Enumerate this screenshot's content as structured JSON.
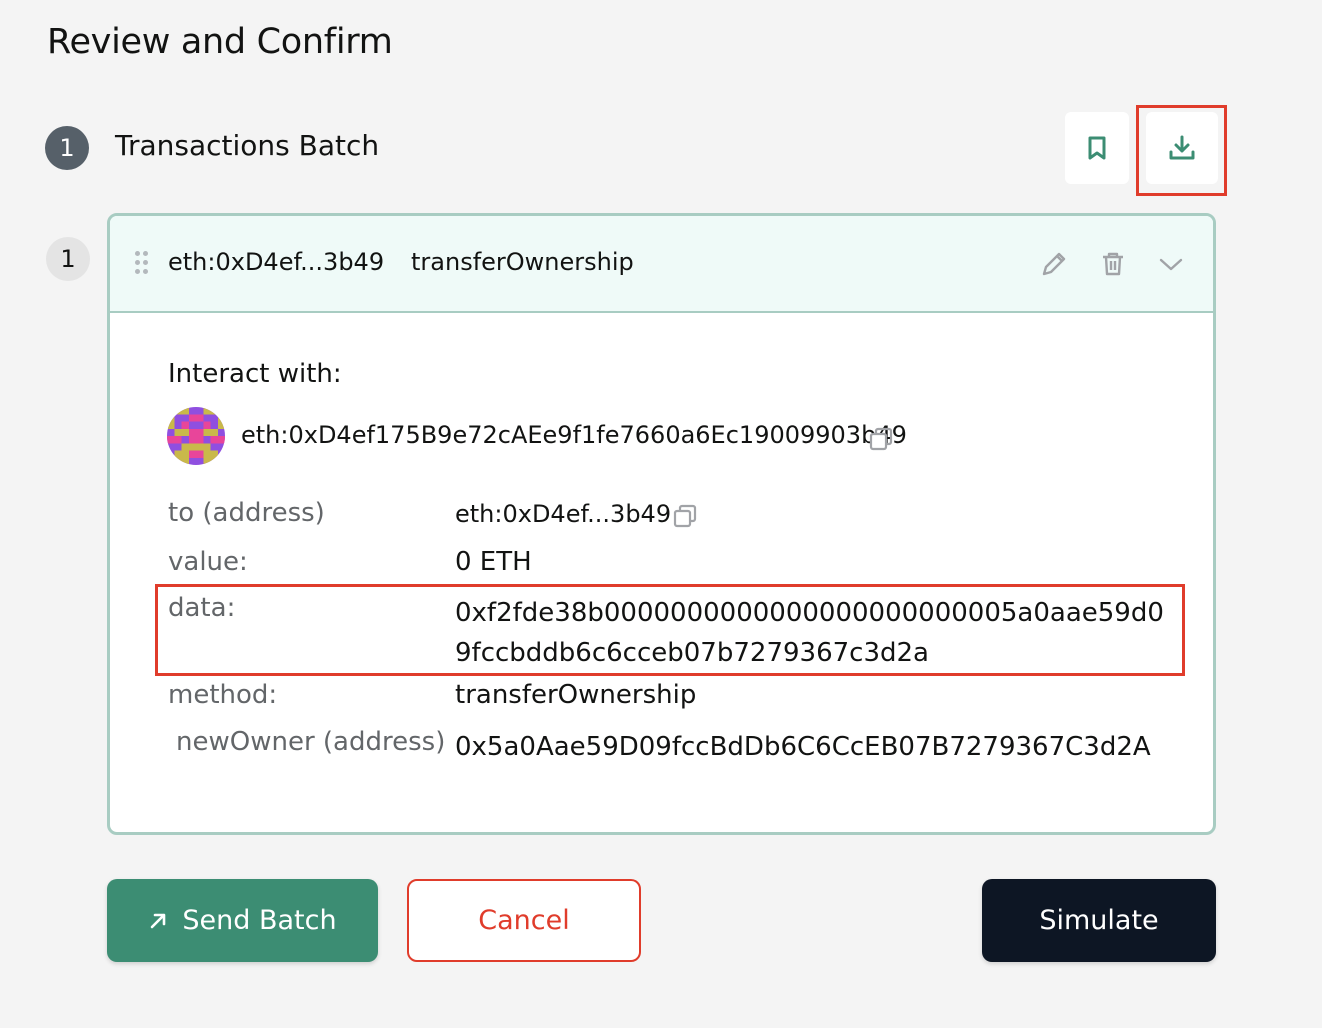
{
  "page": {
    "title": "Review and Confirm"
  },
  "batch": {
    "step_number": "1",
    "title": "Transactions Batch"
  },
  "transaction": {
    "index": "1",
    "short_address": "eth:0xD4ef...3b49",
    "method_name": "transferOwnership",
    "interact_label": "Interact with:",
    "full_address": "eth:0xD4ef175B9e72cAEe9f1fe7660a6Ec19009903b49",
    "fields": {
      "to_label": "to (address)",
      "to_value": "eth:0xD4ef...3b49",
      "value_label": "value:",
      "value_value": "0 ETH",
      "data_label": "data:",
      "data_value": "0xf2fde38b0000000000000000000000005a0aae59d09fccbddb6c6cceb07b7279367c3d2a",
      "method_label": "method:",
      "method_value": "transferOwnership",
      "newowner_label": "newOwner (address)",
      "newowner_value": "0x5a0Aae59D09fccBdDb6C6CcEB07B7279367C3d2A"
    }
  },
  "actions": {
    "send_label": "Send Batch",
    "cancel_label": "Cancel",
    "simulate_label": "Simulate"
  },
  "icons": {
    "bookmark": "bookmark-icon",
    "download": "download-icon",
    "drag": "drag-handle-icon",
    "edit": "pencil-icon",
    "delete": "trash-icon",
    "expand": "chevron-down-icon",
    "copy": "copy-icon",
    "send": "arrow-up-right-icon"
  },
  "colors": {
    "accent_green": "#3c8d73",
    "highlight_red": "#e03c2b",
    "dark_button": "#0d1624",
    "card_border": "#a8ccc2",
    "card_header_bg": "#effaf8"
  }
}
